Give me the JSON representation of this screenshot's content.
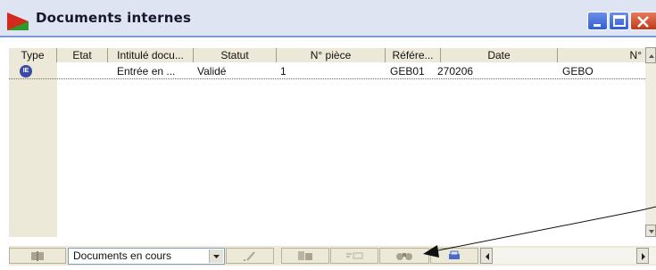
{
  "window": {
    "title": "Documents internes"
  },
  "columns": [
    "Type",
    "Etat",
    "Intitulé docu...",
    "Statut",
    "N° pièce",
    "Référe...",
    "Date",
    "N°"
  ],
  "rows": [
    {
      "type_icon": "internal-doc-icon",
      "etat": "",
      "intitule": "Entrée en ...",
      "statut": "Validé",
      "n_piece": "1",
      "reference": "GEB01",
      "date": "270206",
      "n_tiers": "GEBO"
    }
  ],
  "filter": {
    "selected": "Documents en cours"
  },
  "colors": {
    "titlebar": "#dfe4f3",
    "accent": "#2f5ed6",
    "close": "#c13a1c",
    "toolbar": "#ece9d8"
  }
}
